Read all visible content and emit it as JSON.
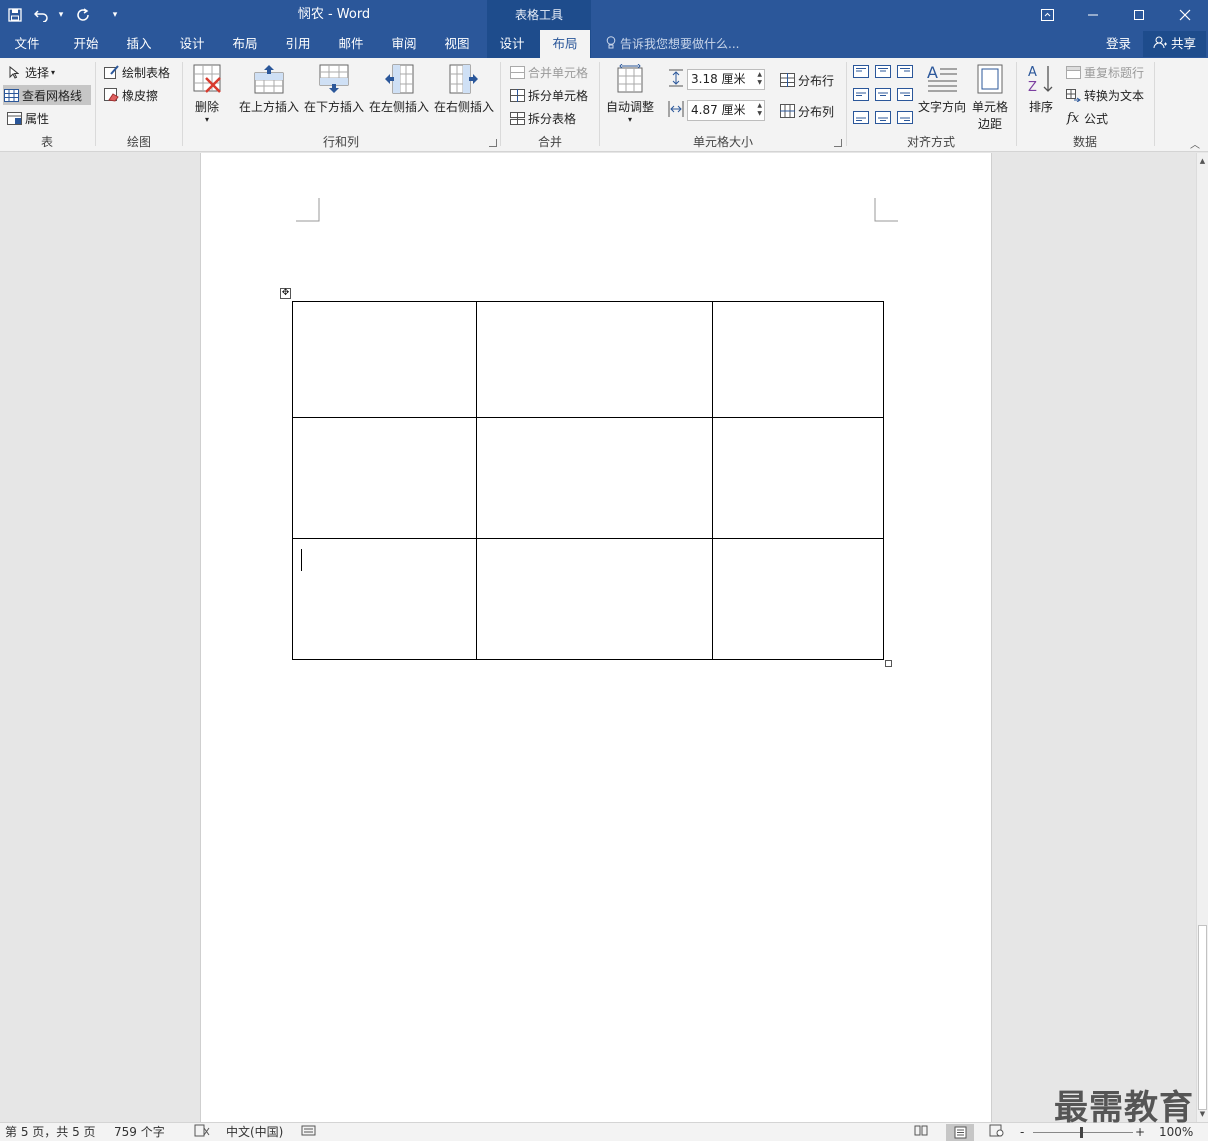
{
  "app": {
    "doc_title": "悯农 - Word",
    "context_title": "表格工具"
  },
  "tabs": [
    {
      "label": "文件"
    },
    {
      "label": "开始"
    },
    {
      "label": "插入"
    },
    {
      "label": "设计"
    },
    {
      "label": "布局"
    },
    {
      "label": "引用"
    },
    {
      "label": "邮件"
    },
    {
      "label": "审阅"
    },
    {
      "label": "视图"
    },
    {
      "label": "设计"
    },
    {
      "label": "布局"
    }
  ],
  "tell_me": "告诉我您想要做什么...",
  "account": {
    "login": "登录",
    "share": "共享"
  },
  "ribbon": {
    "table": {
      "select": "选择",
      "view_gridlines": "查看网格线",
      "properties": "属性",
      "label": "表"
    },
    "draw": {
      "draw_table": "绘制表格",
      "eraser": "橡皮擦",
      "label": "绘图"
    },
    "rows_cols": {
      "delete": "删除",
      "insert_above": "在上方插入",
      "insert_below": "在下方插入",
      "insert_left": "在左侧插入",
      "insert_right": "在右侧插入",
      "label": "行和列"
    },
    "merge": {
      "merge_cells": "合并单元格",
      "split_cells": "拆分单元格",
      "split_table": "拆分表格",
      "label": "合并"
    },
    "cell_size": {
      "autofit": "自动调整",
      "height": "3.18 厘米",
      "width": "4.87 厘米",
      "distribute_rows": "分布行",
      "distribute_cols": "分布列",
      "label": "单元格大小"
    },
    "alignment": {
      "text_direction": "文字方向",
      "cell_margins": "单元格\n边距",
      "cell_margins_1": "单元格",
      "cell_margins_2": "边距",
      "label": "对齐方式"
    },
    "data": {
      "sort": "排序",
      "repeat_header": "重复标题行",
      "convert_text": "转换为文本",
      "formula": "公式",
      "label": "数据"
    }
  },
  "status": {
    "page": "第 5 页，共 5 页",
    "words": "759 个字",
    "language": "中文(中国)",
    "zoom": "100%"
  },
  "watermark": "最需教育",
  "colors": {
    "accent": "#2b579a",
    "context": "#1e4c8c"
  }
}
